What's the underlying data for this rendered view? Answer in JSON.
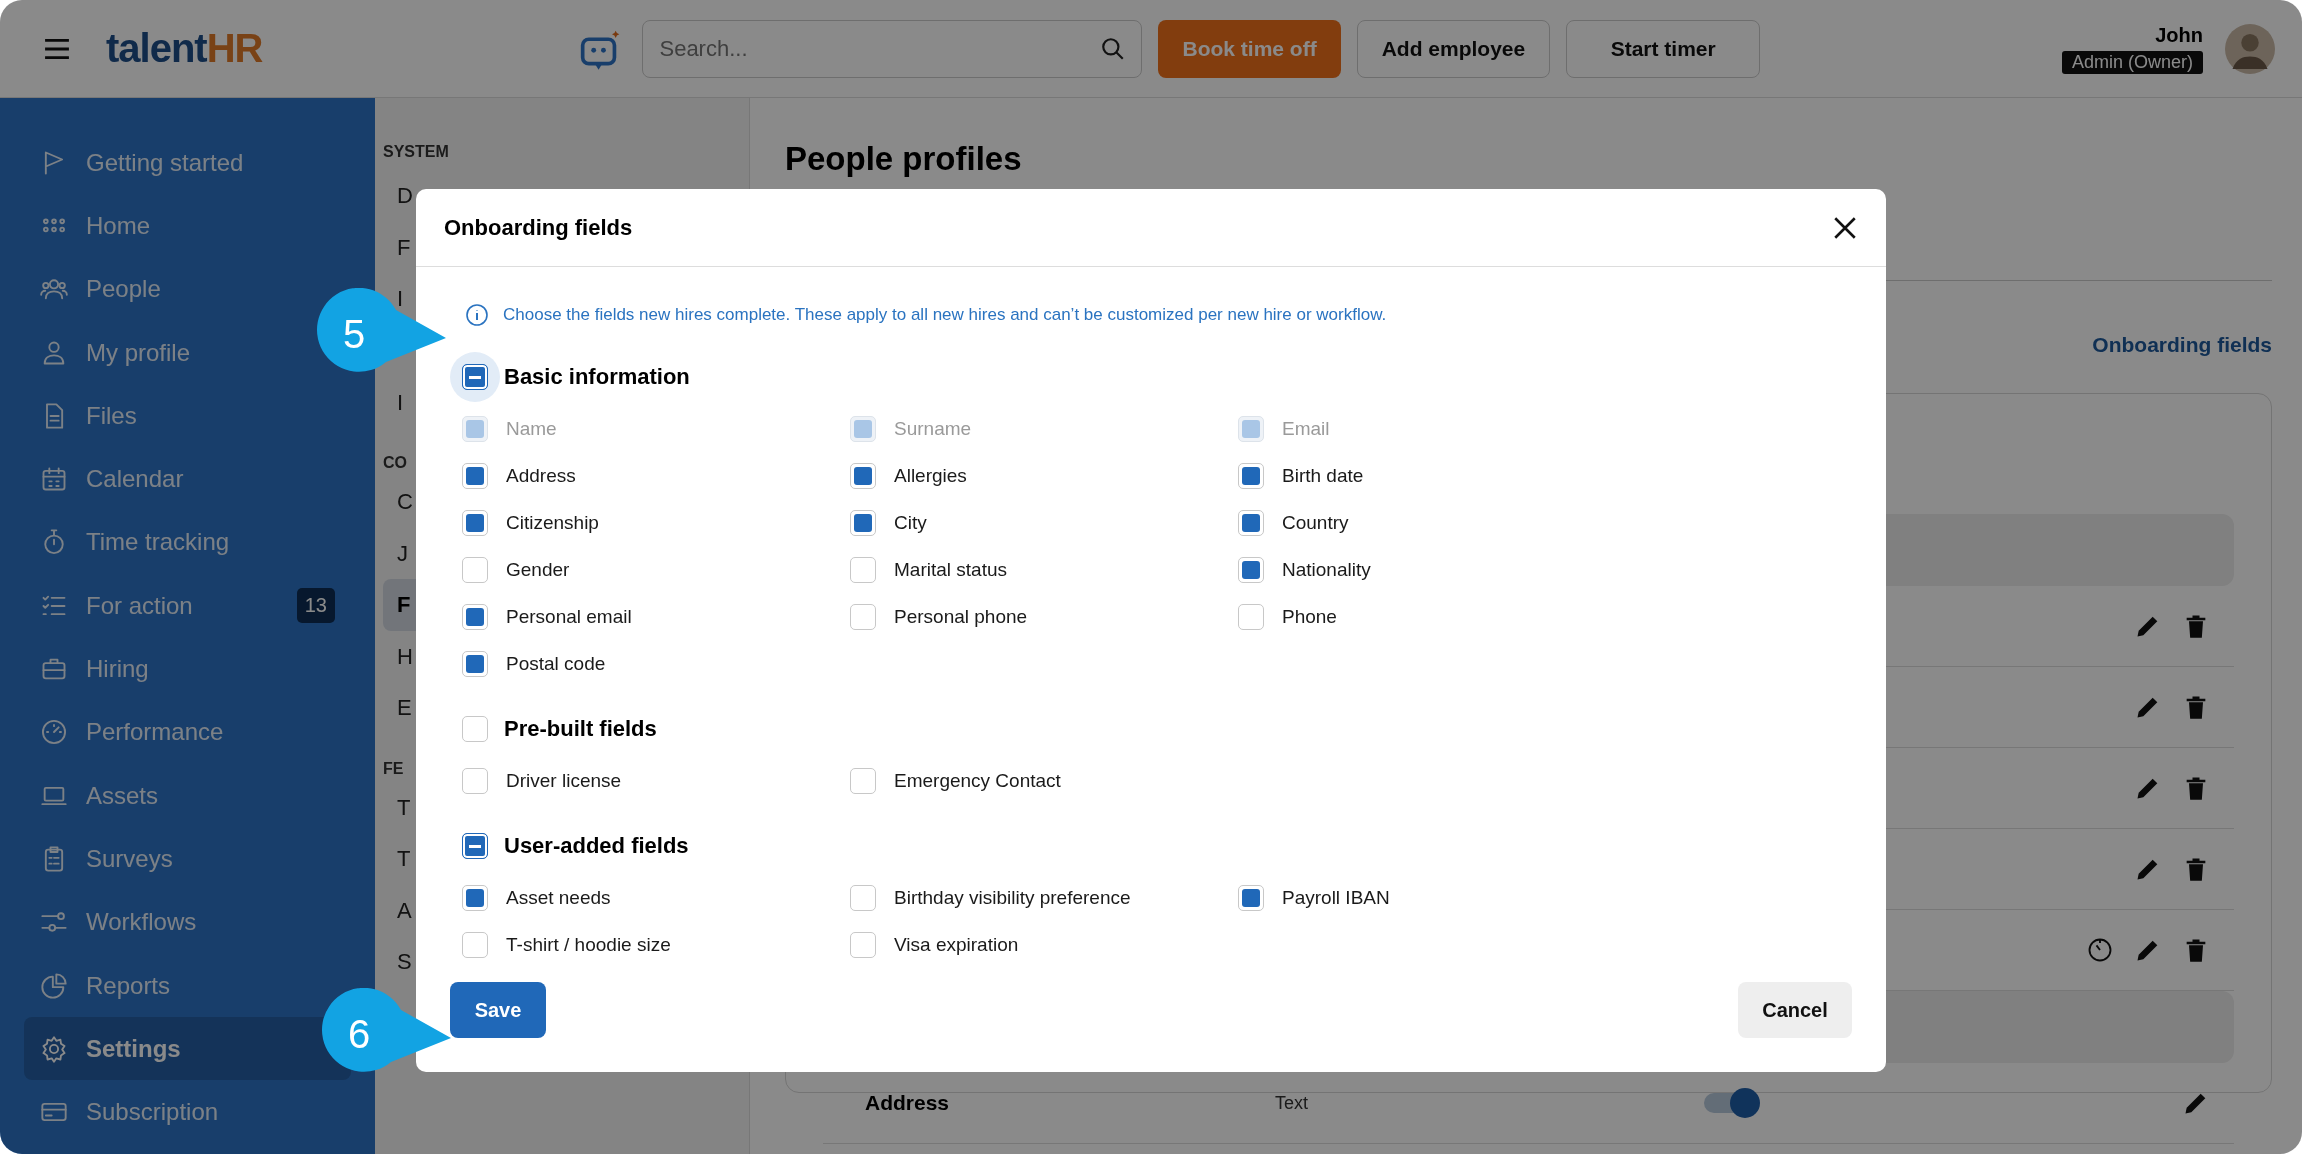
{
  "topbar": {
    "brand_main": "talent",
    "brand_accent": "HR",
    "search": {
      "placeholder": "Search..."
    },
    "buttons": [
      {
        "label": "Book time off",
        "kind": "primary"
      },
      {
        "label": "Add employee",
        "kind": "secondary"
      },
      {
        "label": "Start timer",
        "kind": "secondary"
      }
    ],
    "user": {
      "name": "John",
      "role": "Admin (Owner)"
    }
  },
  "sidebar": {
    "items": [
      {
        "label": "Getting started",
        "selected": false
      },
      {
        "label": "Home",
        "selected": false
      },
      {
        "label": "People",
        "selected": false
      },
      {
        "label": "My profile",
        "selected": false
      },
      {
        "label": "Files",
        "selected": false
      },
      {
        "label": "Calendar",
        "selected": false
      },
      {
        "label": "Time tracking",
        "selected": false
      },
      {
        "label": "For action",
        "selected": false,
        "badge": "13"
      },
      {
        "label": "Hiring",
        "selected": false
      },
      {
        "label": "Performance",
        "selected": false
      },
      {
        "label": "Assets",
        "selected": false
      },
      {
        "label": "Surveys",
        "selected": false
      },
      {
        "label": "Workflows",
        "selected": false
      },
      {
        "label": "Reports",
        "selected": false
      },
      {
        "label": "Settings",
        "selected": true
      },
      {
        "label": "Subscription",
        "selected": false
      }
    ]
  },
  "settings_nav": {
    "sections": [
      {
        "title": "SYSTEM",
        "items": [
          {
            "label": "D",
            "selected": false
          },
          {
            "label": "F",
            "selected": false
          },
          {
            "label": "I",
            "selected": false
          },
          {
            "label": "I",
            "selected": false
          }
        ]
      },
      {
        "title": "CO",
        "items": [
          {
            "label": "C",
            "selected": false
          },
          {
            "label": "J",
            "selected": false
          },
          {
            "label": "F",
            "selected": true
          },
          {
            "label": "H",
            "selected": false
          },
          {
            "label": "E",
            "selected": false
          }
        ]
      },
      {
        "title": "FE",
        "items": [
          {
            "label": "T",
            "selected": false
          },
          {
            "label": "T",
            "selected": false
          },
          {
            "label": "A",
            "selected": false
          },
          {
            "label": "S",
            "selected": false
          }
        ]
      }
    ]
  },
  "main": {
    "title": "People profiles",
    "link": "Onboarding fields",
    "rows": [
      {
        "kind": "band"
      },
      {
        "kind": "field",
        "timer": false,
        "deletable": true
      },
      {
        "kind": "field",
        "timer": false,
        "deletable": true
      },
      {
        "kind": "field",
        "timer": false,
        "deletable": true
      },
      {
        "kind": "field",
        "timer": false,
        "deletable": true
      },
      {
        "kind": "field",
        "timer": true,
        "deletable": true
      },
      {
        "kind": "band"
      },
      {
        "kind": "field",
        "label": "Address",
        "type": "Text",
        "on": true,
        "timer": false,
        "deletable": false
      }
    ]
  },
  "modal": {
    "title": "Onboarding fields",
    "info": "Choose the fields new hires complete. These apply to all new hires and can’t be customized per new hire or workflow.",
    "groups": [
      {
        "label": "Basic information",
        "indeterminate": true,
        "focused": true,
        "fields": [
          {
            "label": "Name",
            "checked": true,
            "disabled": true
          },
          {
            "label": "Surname",
            "checked": true,
            "disabled": true
          },
          {
            "label": "Email",
            "checked": true,
            "disabled": true
          },
          {
            "label": "Address",
            "checked": true,
            "disabled": false
          },
          {
            "label": "Allergies",
            "checked": true,
            "disabled": false
          },
          {
            "label": "Birth date",
            "checked": true,
            "disabled": false
          },
          {
            "label": "Citizenship",
            "checked": true,
            "disabled": false
          },
          {
            "label": "City",
            "checked": true,
            "disabled": false
          },
          {
            "label": "Country",
            "checked": true,
            "disabled": false
          },
          {
            "label": "Gender",
            "checked": false,
            "disabled": false
          },
          {
            "label": "Marital status",
            "checked": false,
            "disabled": false
          },
          {
            "label": "Nationality",
            "checked": true,
            "disabled": false
          },
          {
            "label": "Personal email",
            "checked": true,
            "disabled": false
          },
          {
            "label": "Personal phone",
            "checked": false,
            "disabled": false
          },
          {
            "label": "Phone",
            "checked": false,
            "disabled": false
          },
          {
            "label": "Postal code",
            "checked": true,
            "disabled": false
          }
        ]
      },
      {
        "label": "Pre-built fields",
        "indeterminate": false,
        "focused": false,
        "fields": [
          {
            "label": "Driver license",
            "checked": false,
            "disabled": false
          },
          {
            "label": "Emergency Contact",
            "checked": false,
            "disabled": false
          }
        ]
      },
      {
        "label": "User-added fields",
        "indeterminate": true,
        "focused": false,
        "fields": [
          {
            "label": "Asset needs",
            "checked": true,
            "disabled": false
          },
          {
            "label": "Birthday visibility preference",
            "checked": false,
            "disabled": false
          },
          {
            "label": "Payroll IBAN",
            "checked": true,
            "disabled": false
          },
          {
            "label": "T-shirt / hoodie size",
            "checked": false,
            "disabled": false
          },
          {
            "label": "Visa expiration",
            "checked": false,
            "disabled": false
          }
        ]
      }
    ],
    "save": "Save",
    "cancel": "Cancel"
  },
  "callouts": [
    {
      "number": "5"
    },
    {
      "number": "6"
    }
  ]
}
